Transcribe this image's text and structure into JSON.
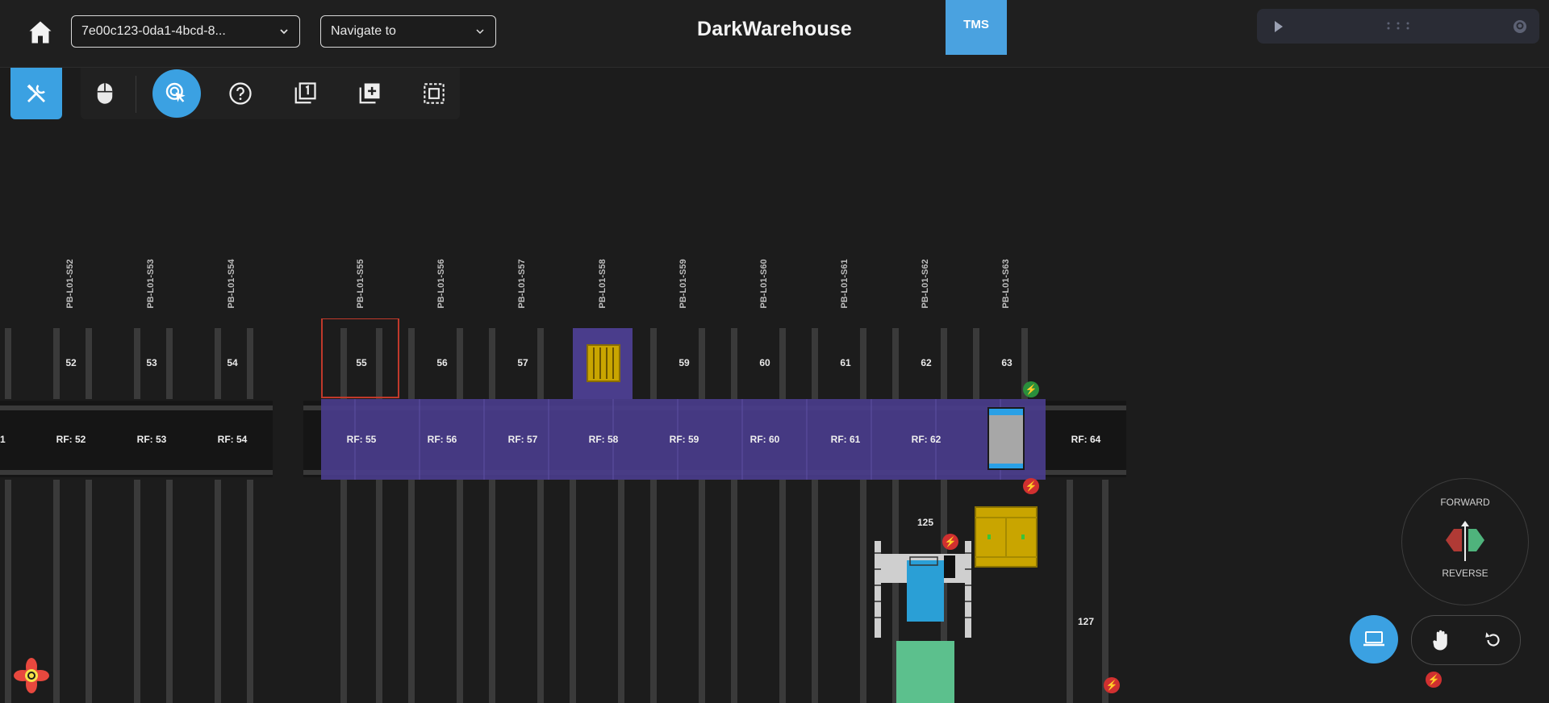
{
  "header": {
    "session_select": "7e00c123-0da1-4bcd-8...",
    "navigate_placeholder": "Navigate to",
    "title": "DarkWarehouse",
    "tms_tab": "TMS"
  },
  "locations": {
    "labels": [
      "PB-L01-S52",
      "PB-L01-S53",
      "PB-L01-S54",
      "PB-L01-S55",
      "PB-L01-S56",
      "PB-L01-S57",
      "PB-L01-S58",
      "PB-L01-S59",
      "PB-L01-S60",
      "PB-L01-S61",
      "PB-L01-S62",
      "PB-L01-S63"
    ],
    "numbers": [
      "52",
      "53",
      "54",
      "55",
      "56",
      "57",
      "59",
      "60",
      "61",
      "62",
      "63"
    ],
    "rf": [
      "RF: 52",
      "RF: 53",
      "RF: 54",
      "RF: 55",
      "RF: 56",
      "RF: 57",
      "RF: 58",
      "RF: 59",
      "RF: 60",
      "RF: 61",
      "RF: 62",
      "RF: 64"
    ],
    "edge_label": "1",
    "lower": [
      "125",
      "127"
    ]
  },
  "direction": {
    "forward": "FORWARD",
    "reverse": "REVERSE"
  },
  "colors": {
    "accent": "#3ba1e2",
    "zone": "#4a3d8c",
    "selection": "#c0392b",
    "cargo": "#c9a500",
    "agv": "#2a9fd6",
    "dock": "#5cc08d"
  }
}
